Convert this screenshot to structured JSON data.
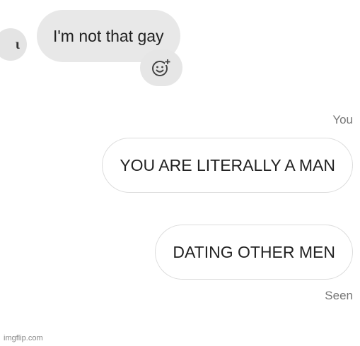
{
  "incoming": {
    "avatar_letter": "ι",
    "message": "I'm not that gay",
    "react_icon": "add-reaction-icon"
  },
  "outgoing": {
    "sender_label": "You",
    "messages": [
      "YOU ARE LITERALLY A MAN",
      "DATING OTHER MEN"
    ],
    "status": "Seen"
  },
  "watermark": "imgflip.com",
  "colors": {
    "incoming_bubble": "#e8e8e8",
    "outgoing_border": "#dcdcdc",
    "meta_text": "#777777",
    "background": "#ffffff"
  }
}
